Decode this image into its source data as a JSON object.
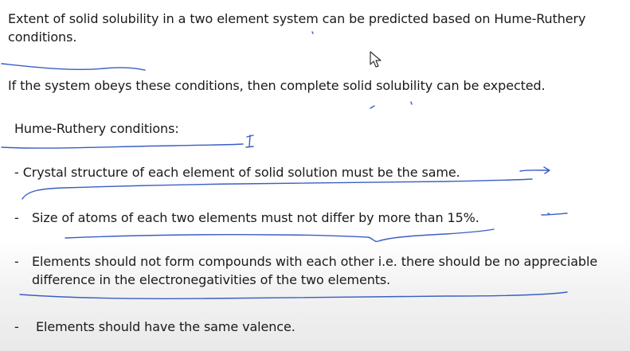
{
  "paragraphs": {
    "intro": "Extent of solid solubility in a two element system can be predicted based on Hume-Ruthery conditions.",
    "obey": "If the system obeys these conditions, then complete solid solubility can be expected."
  },
  "heading": "Hume-Ruthery conditions:",
  "conditions": [
    {
      "marker": "-",
      "text": "Crystal structure of each element of solid solution must be the same."
    },
    {
      "marker": "-",
      "text": "Size of atoms of each two elements must not differ by more than 15%."
    },
    {
      "marker": "-",
      "text": "Elements should not form compounds with each other i.e. there should be no appreciable difference in the electronegativities of the two elements."
    },
    {
      "marker": "-",
      "text": "Elements should have the same valence."
    }
  ],
  "annotation_color": "#3a5fc4",
  "cursor_icon": "mouse-pointer-icon"
}
